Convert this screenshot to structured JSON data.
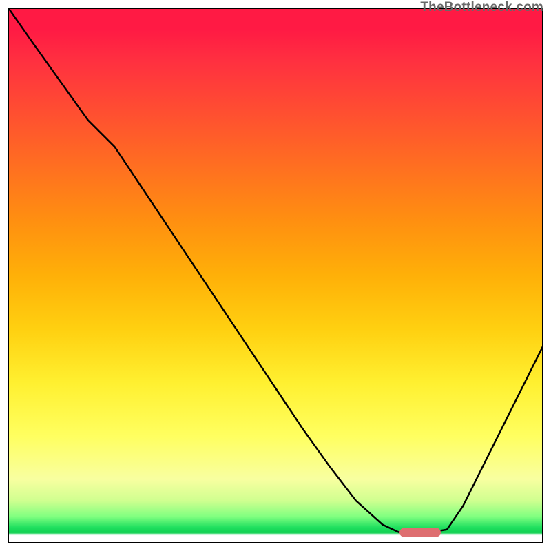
{
  "watermark": "TheBottleneck.com",
  "colors": {
    "curve": "#000000",
    "marker": "#de6e70",
    "frame": "#000000"
  },
  "chart_data": {
    "type": "line",
    "title": "",
    "xlabel": "",
    "ylabel": "",
    "xlim": [
      0,
      100
    ],
    "ylim": [
      0,
      100
    ],
    "grid": false,
    "series": [
      {
        "name": "bottleneck-curve",
        "x": [
          0.3,
          5,
          10,
          15,
          20,
          25,
          30,
          35,
          40,
          45,
          50,
          55,
          60,
          65,
          70,
          73,
          76,
          79,
          82,
          85,
          90,
          95,
          100
        ],
        "y": [
          99.7,
          93,
          86,
          79,
          74,
          66.5,
          59,
          51.5,
          44,
          36.5,
          29,
          21.5,
          14.5,
          8,
          3.5,
          2.1,
          2.1,
          2.1,
          2.6,
          7,
          17,
          27,
          37
        ]
      }
    ],
    "marker": {
      "x": 77,
      "y": 2.0
    },
    "annotations": []
  }
}
